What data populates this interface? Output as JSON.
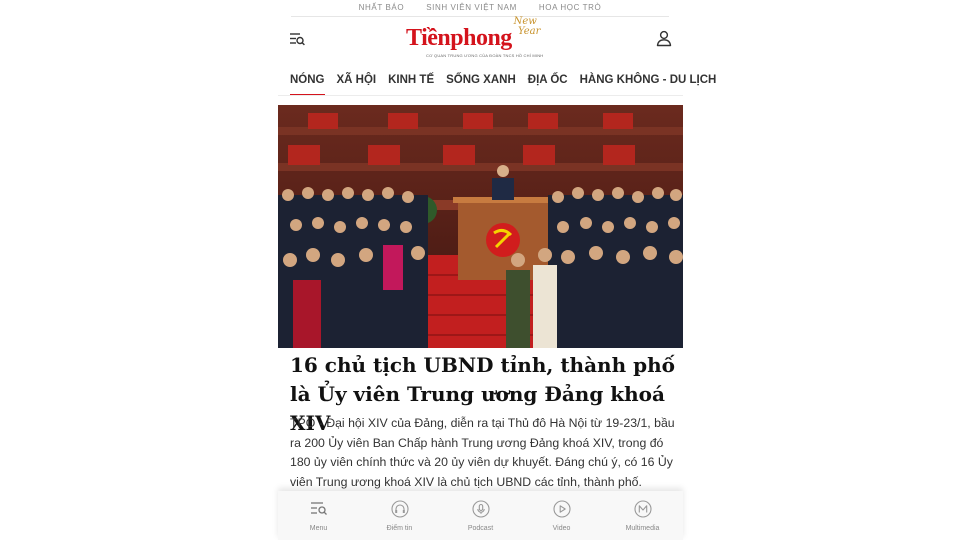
{
  "partner_links": [
    "NHẤT BÁO",
    "SINH VIÊN VIỆT NAM",
    "HOA HỌC TRÒ"
  ],
  "logo": {
    "name": "Tiềnphong",
    "badge_line1": "New",
    "badge_line2": "Year",
    "tagline": "CƠ QUAN TRUNG ƯƠNG CỦA ĐOÀN TNCS HỒ CHÍ MINH"
  },
  "nav": {
    "items": [
      "NÓNG",
      "XÃ HỘI",
      "KINH TẾ",
      "SỐNG XANH",
      "ĐỊA ỐC",
      "HÀNG KHÔNG - DU LỊCH"
    ],
    "active_index": 0
  },
  "article": {
    "headline": "16 chủ tịch UBND tỉnh, thành phố là Ủy viên Trung ương Đảng khoá XIV",
    "sapo": "TPO - Đại hội XIV của Đảng, diễn ra tại Thủ đô Hà Nội từ 19-23/1, bầu ra 200 Ủy viên Ban Chấp hành Trung ương Đảng khoá XIV, trong đó 180 ủy viên chính thức và 20 ủy viên dự khuyết. Đáng chú ý, có 16 Ủy viên Trung ương khoá XIV là chủ tịch UBND các tỉnh, thành phố."
  },
  "bottom_nav": [
    {
      "label": "Menu",
      "icon": "menu-search-icon"
    },
    {
      "label": "Điểm tin",
      "icon": "headphones-icon"
    },
    {
      "label": "Podcast",
      "icon": "microphone-icon"
    },
    {
      "label": "Video",
      "icon": "play-circle-icon"
    },
    {
      "label": "Multimedia",
      "icon": "multimedia-m-icon"
    }
  ],
  "colors": {
    "brand_red": "#d4131c",
    "accent_gold": "#c8932c"
  }
}
